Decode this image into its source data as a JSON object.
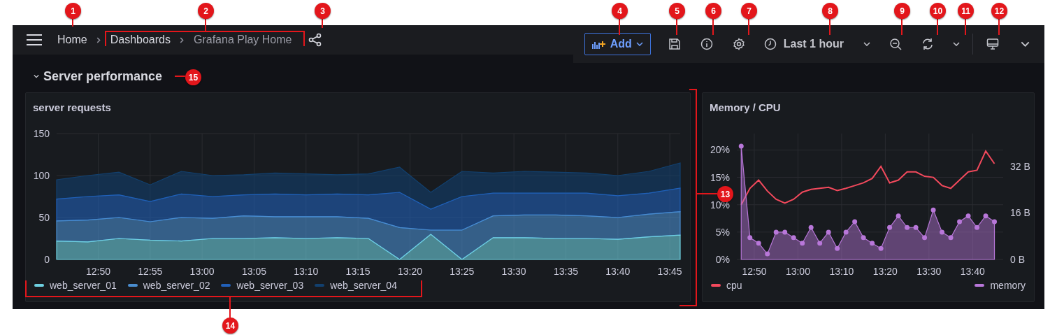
{
  "header": {
    "breadcrumbs": [
      {
        "label": "Home",
        "current": false
      },
      {
        "label": "Dashboards",
        "current": false
      },
      {
        "label": "Grafana Play Home",
        "current": true
      }
    ],
    "add_button": {
      "label": "Add"
    },
    "time_range": {
      "label": "Last 1 hour"
    }
  },
  "section": {
    "title": "Server performance",
    "expanded": true
  },
  "panels": [
    {
      "title": "server requests",
      "chart_data": {
        "type": "area",
        "stacked": true,
        "grid": true,
        "x": [
          766,
          769,
          772,
          775,
          778,
          781,
          784,
          787,
          790,
          793,
          796,
          799,
          802,
          805,
          808,
          811,
          814,
          817,
          820,
          823,
          826
        ],
        "xlim": [
          766,
          826
        ],
        "xticks": [
          {
            "value": 770,
            "label": "12:50"
          },
          {
            "value": 775,
            "label": "12:55"
          },
          {
            "value": 780,
            "label": "13:00"
          },
          {
            "value": 785,
            "label": "13:05"
          },
          {
            "value": 790,
            "label": "13:10"
          },
          {
            "value": 795,
            "label": "13:15"
          },
          {
            "value": 800,
            "label": "13:20"
          },
          {
            "value": 805,
            "label": "13:25"
          },
          {
            "value": 810,
            "label": "13:30"
          },
          {
            "value": 815,
            "label": "13:35"
          },
          {
            "value": 820,
            "label": "13:40"
          },
          {
            "value": 825,
            "label": "13:45"
          }
        ],
        "ylim": [
          0,
          150
        ],
        "yticks": [
          0,
          50,
          100,
          150
        ],
        "series": [
          {
            "name": "web_server_01",
            "color": "#6ed0e0",
            "values": [
              22,
              21,
              25,
              23,
              22,
              25,
              25,
              26,
              25,
              26,
              25,
              0,
              30,
              0,
              26,
              26,
              25,
              25,
              24,
              27,
              29
            ]
          },
          {
            "name": "web_server_02",
            "color": "#4a8dcf",
            "values": [
              24,
              26,
              25,
              22,
              28,
              24,
              27,
              25,
              26,
              25,
              24,
              38,
              5,
              35,
              26,
              27,
              28,
              27,
              26,
              27,
              28
            ]
          },
          {
            "name": "web_server_03",
            "color": "#2160b8",
            "values": [
              26,
              28,
              27,
              24,
              28,
              26,
              25,
              27,
              26,
              27,
              28,
              42,
              25,
              40,
              27,
              26,
              26,
              27,
              26,
              25,
              28
            ]
          },
          {
            "name": "web_server_04",
            "color": "#12406e",
            "values": [
              23,
              25,
              27,
              20,
              27,
              25,
              24,
              25,
              25,
              23,
              25,
              30,
              20,
              30,
              24,
              26,
              25,
              24,
              24,
              26,
              30
            ]
          }
        ]
      }
    },
    {
      "title": "Memory / CPU",
      "chart_data": {
        "type": "line",
        "grid": true,
        "x": [
          767,
          769,
          771,
          773,
          775,
          777,
          779,
          781,
          783,
          785,
          787,
          789,
          791,
          793,
          795,
          797,
          799,
          801,
          803,
          805,
          807,
          809,
          811,
          813,
          815,
          817,
          819,
          821,
          823,
          825
        ],
        "xlim": [
          766,
          827
        ],
        "xticks": [
          {
            "value": 770,
            "label": "12:50"
          },
          {
            "value": 780,
            "label": "13:00"
          },
          {
            "value": 790,
            "label": "13:10"
          },
          {
            "value": 800,
            "label": "13:20"
          },
          {
            "value": 810,
            "label": "13:30"
          },
          {
            "value": 820,
            "label": "13:40"
          }
        ],
        "ylim": [
          0,
          23
        ],
        "yticks": [
          {
            "value": 0,
            "label": "0%"
          },
          {
            "value": 5,
            "label": "5%"
          },
          {
            "value": 10,
            "label": "10%"
          },
          {
            "value": 15,
            "label": "15%"
          },
          {
            "value": 20,
            "label": "20%"
          }
        ],
        "y2lim": [
          0,
          43.3
        ],
        "y2ticks": [
          {
            "value": 0,
            "label": "0 B"
          },
          {
            "value": 16,
            "label": "16 B"
          },
          {
            "value": 32,
            "label": "32 B"
          }
        ],
        "series": [
          {
            "name": "cpu",
            "color": "#f2495c",
            "type": "line",
            "values": [
              10,
              13,
              14.5,
              12.5,
              11,
              10.3,
              11,
              12.3,
              12.8,
              13,
              13.2,
              12.6,
              13,
              13.5,
              14,
              14.8,
              17,
              14,
              14.5,
              16,
              16,
              15.2,
              15,
              13.5,
              13,
              14.5,
              16,
              16.3,
              19.8,
              17.5
            ]
          },
          {
            "name": "memory",
            "color": "#b877d9",
            "type": "area",
            "axis": "y2",
            "values": [
              39,
              7.5,
              5.6,
              1.9,
              9.4,
              9.4,
              7.5,
              5.6,
              11,
              5.6,
              9.4,
              3.8,
              9.4,
              13,
              7.5,
              5.6,
              3.8,
              11,
              15,
              11,
              11,
              7.5,
              17,
              9.4,
              7.5,
              13,
              15,
              11,
              15,
              13
            ]
          }
        ]
      }
    }
  ],
  "annotations": [
    {
      "number": "1"
    },
    {
      "number": "2"
    },
    {
      "number": "3"
    },
    {
      "number": "4"
    },
    {
      "number": "5"
    },
    {
      "number": "6"
    },
    {
      "number": "7"
    },
    {
      "number": "8"
    },
    {
      "number": "9"
    },
    {
      "number": "10"
    },
    {
      "number": "11"
    },
    {
      "number": "12"
    },
    {
      "number": "13"
    },
    {
      "number": "14"
    },
    {
      "number": "15"
    }
  ]
}
